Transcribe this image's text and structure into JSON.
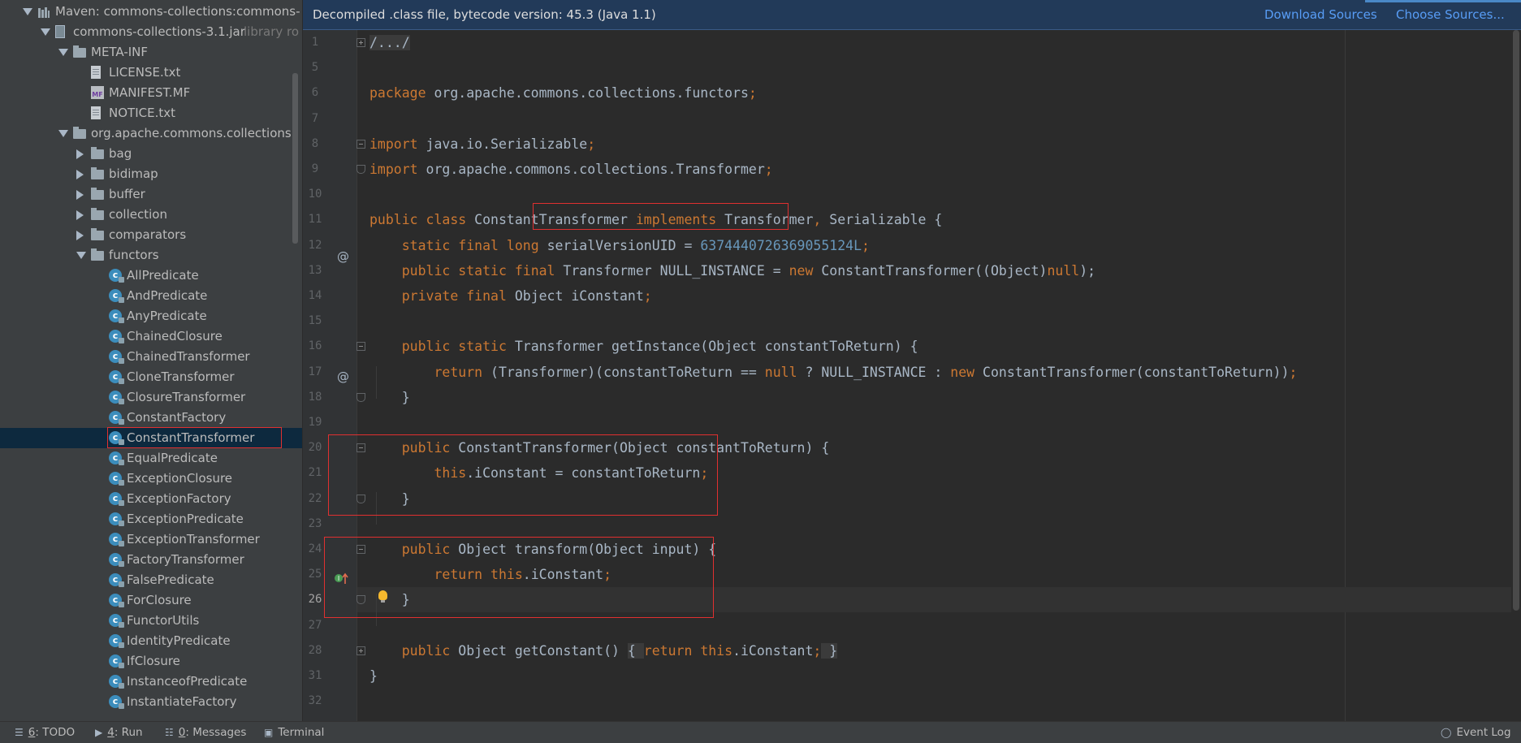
{
  "tree": {
    "rows": [
      {
        "label": "Maven: commons-collections:commons-",
        "icon": "library-icon",
        "indent": 0,
        "arrow": "open"
      },
      {
        "label": "commons-collections-3.1.jar",
        "hint": "library ro",
        "icon": "jar-icon",
        "indent": 1,
        "arrow": "open"
      },
      {
        "label": "META-INF",
        "icon": "folder-icon",
        "indent": 2,
        "arrow": "open"
      },
      {
        "label": "LICENSE.txt",
        "icon": "text-file-icon",
        "indent": 3,
        "arrow": ""
      },
      {
        "label": "MANIFEST.MF",
        "icon": "manifest-file-icon",
        "indent": 3,
        "arrow": ""
      },
      {
        "label": "NOTICE.txt",
        "icon": "text-file-icon",
        "indent": 3,
        "arrow": ""
      },
      {
        "label": "org.apache.commons.collections",
        "icon": "package-icon",
        "indent": 2,
        "arrow": "open"
      },
      {
        "label": "bag",
        "icon": "package-icon",
        "indent": 3,
        "arrow": "closed"
      },
      {
        "label": "bidimap",
        "icon": "package-icon",
        "indent": 3,
        "arrow": "closed"
      },
      {
        "label": "buffer",
        "icon": "package-icon",
        "indent": 3,
        "arrow": "closed"
      },
      {
        "label": "collection",
        "icon": "package-icon",
        "indent": 3,
        "arrow": "closed"
      },
      {
        "label": "comparators",
        "icon": "package-icon",
        "indent": 3,
        "arrow": "closed"
      },
      {
        "label": "functors",
        "icon": "package-icon",
        "indent": 3,
        "arrow": "open"
      },
      {
        "label": "AllPredicate",
        "icon": "class-icon",
        "indent": 4,
        "arrow": ""
      },
      {
        "label": "AndPredicate",
        "icon": "class-icon",
        "indent": 4,
        "arrow": ""
      },
      {
        "label": "AnyPredicate",
        "icon": "class-icon",
        "indent": 4,
        "arrow": ""
      },
      {
        "label": "ChainedClosure",
        "icon": "class-icon",
        "indent": 4,
        "arrow": ""
      },
      {
        "label": "ChainedTransformer",
        "icon": "class-icon",
        "indent": 4,
        "arrow": ""
      },
      {
        "label": "CloneTransformer",
        "icon": "class-icon",
        "indent": 4,
        "arrow": ""
      },
      {
        "label": "ClosureTransformer",
        "icon": "class-icon",
        "indent": 4,
        "arrow": ""
      },
      {
        "label": "ConstantFactory",
        "icon": "class-icon",
        "indent": 4,
        "arrow": ""
      },
      {
        "label": "ConstantTransformer",
        "icon": "class-icon",
        "indent": 4,
        "arrow": "",
        "selected": true
      },
      {
        "label": "EqualPredicate",
        "icon": "class-icon",
        "indent": 4,
        "arrow": ""
      },
      {
        "label": "ExceptionClosure",
        "icon": "class-icon",
        "indent": 4,
        "arrow": ""
      },
      {
        "label": "ExceptionFactory",
        "icon": "class-icon",
        "indent": 4,
        "arrow": ""
      },
      {
        "label": "ExceptionPredicate",
        "icon": "class-icon",
        "indent": 4,
        "arrow": ""
      },
      {
        "label": "ExceptionTransformer",
        "icon": "class-icon",
        "indent": 4,
        "arrow": ""
      },
      {
        "label": "FactoryTransformer",
        "icon": "class-icon",
        "indent": 4,
        "arrow": ""
      },
      {
        "label": "FalsePredicate",
        "icon": "class-icon",
        "indent": 4,
        "arrow": ""
      },
      {
        "label": "ForClosure",
        "icon": "class-icon",
        "indent": 4,
        "arrow": ""
      },
      {
        "label": "FunctorUtils",
        "icon": "class-icon",
        "indent": 4,
        "arrow": ""
      },
      {
        "label": "IdentityPredicate",
        "icon": "class-icon",
        "indent": 4,
        "arrow": ""
      },
      {
        "label": "IfClosure",
        "icon": "class-icon",
        "indent": 4,
        "arrow": ""
      },
      {
        "label": "InstanceofPredicate",
        "icon": "class-icon",
        "indent": 4,
        "arrow": ""
      },
      {
        "label": "InstantiateFactory",
        "icon": "class-icon",
        "indent": 4,
        "arrow": ""
      }
    ]
  },
  "banner": {
    "message": "Decompiled .class file, bytecode version: 45.3 (Java 1.1)",
    "download_sources": "Download Sources",
    "choose_sources": "Choose Sources..."
  },
  "editor": {
    "current_line": "26",
    "lines": [
      {
        "n": "1",
        "tokens": [
          {
            "t": "/.../",
            "c": "fold"
          }
        ]
      },
      {
        "n": "5",
        "tokens": []
      },
      {
        "n": "6",
        "tokens": [
          {
            "t": "package",
            "c": "kw"
          },
          {
            "t": " org.apache.commons.collections.functors"
          },
          {
            "t": ";",
            "c": "kw"
          }
        ]
      },
      {
        "n": "7",
        "tokens": []
      },
      {
        "n": "8",
        "tokens": [
          {
            "t": "import",
            "c": "kw"
          },
          {
            "t": " java.io.Serializable"
          },
          {
            "t": ";",
            "c": "kw"
          }
        ]
      },
      {
        "n": "9",
        "tokens": [
          {
            "t": "import",
            "c": "kw"
          },
          {
            "t": " org.apache.commons.collections.Transformer"
          },
          {
            "t": ";",
            "c": "kw"
          }
        ]
      },
      {
        "n": "10",
        "tokens": []
      },
      {
        "n": "11",
        "tokens": [
          {
            "t": "public class",
            "c": "kw"
          },
          {
            "t": " ConstantTransformer "
          },
          {
            "t": "implements",
            "c": "kw"
          },
          {
            "t": " Transformer"
          },
          {
            "t": ",",
            "c": "kw"
          },
          {
            "t": " Serializable {"
          }
        ]
      },
      {
        "n": "12",
        "tokens": [
          {
            "t": "    "
          },
          {
            "t": "static final long",
            "c": "kw"
          },
          {
            "t": " serialVersionUID = "
          },
          {
            "t": "6374440726369055124L",
            "c": "num"
          },
          {
            "t": ";",
            "c": "kw"
          }
        ]
      },
      {
        "n": "13",
        "tokens": [
          {
            "t": "    "
          },
          {
            "t": "public static final",
            "c": "kw"
          },
          {
            "t": " Transformer NULL_INSTANCE = "
          },
          {
            "t": "new",
            "c": "kw"
          },
          {
            "t": " ConstantTransformer((Object)"
          },
          {
            "t": "null",
            "c": "kw"
          },
          {
            "t": ");"
          }
        ]
      },
      {
        "n": "14",
        "tokens": [
          {
            "t": "    "
          },
          {
            "t": "private final",
            "c": "kw"
          },
          {
            "t": " Object iConstant"
          },
          {
            "t": ";",
            "c": "kw"
          }
        ]
      },
      {
        "n": "15",
        "tokens": []
      },
      {
        "n": "16",
        "tokens": [
          {
            "t": "    "
          },
          {
            "t": "public static",
            "c": "kw"
          },
          {
            "t": " Transformer getInstance(Object constantToReturn) {"
          }
        ]
      },
      {
        "n": "17",
        "tokens": [
          {
            "t": "        "
          },
          {
            "t": "return",
            "c": "kw"
          },
          {
            "t": " (Transformer)(constantToReturn == "
          },
          {
            "t": "null",
            "c": "kw"
          },
          {
            "t": " ? NULL_INSTANCE : "
          },
          {
            "t": "new",
            "c": "kw"
          },
          {
            "t": " ConstantTransformer(constantToReturn))"
          },
          {
            "t": ";",
            "c": "kw"
          }
        ]
      },
      {
        "n": "18",
        "tokens": [
          {
            "t": "    }"
          }
        ]
      },
      {
        "n": "19",
        "tokens": []
      },
      {
        "n": "20",
        "tokens": [
          {
            "t": "    "
          },
          {
            "t": "public",
            "c": "kw"
          },
          {
            "t": " ConstantTransformer(Object constantToReturn) {"
          }
        ]
      },
      {
        "n": "21",
        "tokens": [
          {
            "t": "        "
          },
          {
            "t": "this",
            "c": "kw"
          },
          {
            "t": ".iConstant = constantToReturn"
          },
          {
            "t": ";",
            "c": "kw"
          }
        ]
      },
      {
        "n": "22",
        "tokens": [
          {
            "t": "    }"
          }
        ]
      },
      {
        "n": "23",
        "tokens": []
      },
      {
        "n": "24",
        "tokens": [
          {
            "t": "    "
          },
          {
            "t": "public",
            "c": "kw"
          },
          {
            "t": " Object transform(Object input) {"
          }
        ]
      },
      {
        "n": "25",
        "tokens": [
          {
            "t": "        "
          },
          {
            "t": "return this",
            "c": "kw"
          },
          {
            "t": ".iConstant"
          },
          {
            "t": ";",
            "c": "kw"
          }
        ]
      },
      {
        "n": "26",
        "tokens": [
          {
            "t": "    }"
          }
        ]
      },
      {
        "n": "27",
        "tokens": []
      },
      {
        "n": "28",
        "tokens": [
          {
            "t": "    "
          },
          {
            "t": "public",
            "c": "kw"
          },
          {
            "t": " Object getConstant() "
          },
          {
            "t": "{ ",
            "c": "fold"
          },
          {
            "t": "return this",
            "c": "kw"
          },
          {
            "t": ".iConstant"
          },
          {
            "t": ";",
            "c": "kw"
          },
          {
            "t": " }",
            "c": "fold"
          }
        ]
      },
      {
        "n": "31",
        "tokens": [
          {
            "t": "}"
          }
        ]
      },
      {
        "n": "32",
        "tokens": []
      }
    ]
  },
  "status_bar": {
    "todo_num": "6",
    "todo_label": ": TODO",
    "run_num": "4",
    "run_label": ": Run",
    "messages_num": "0",
    "messages_label": ": Messages",
    "terminal": "Terminal",
    "event_log": "Event Log"
  },
  "colors": {
    "keyword": "#cc7832",
    "number": "#6897bb",
    "text": "#a9b7c6",
    "highlight_box": "#e03030",
    "selection": "#0d293e"
  }
}
